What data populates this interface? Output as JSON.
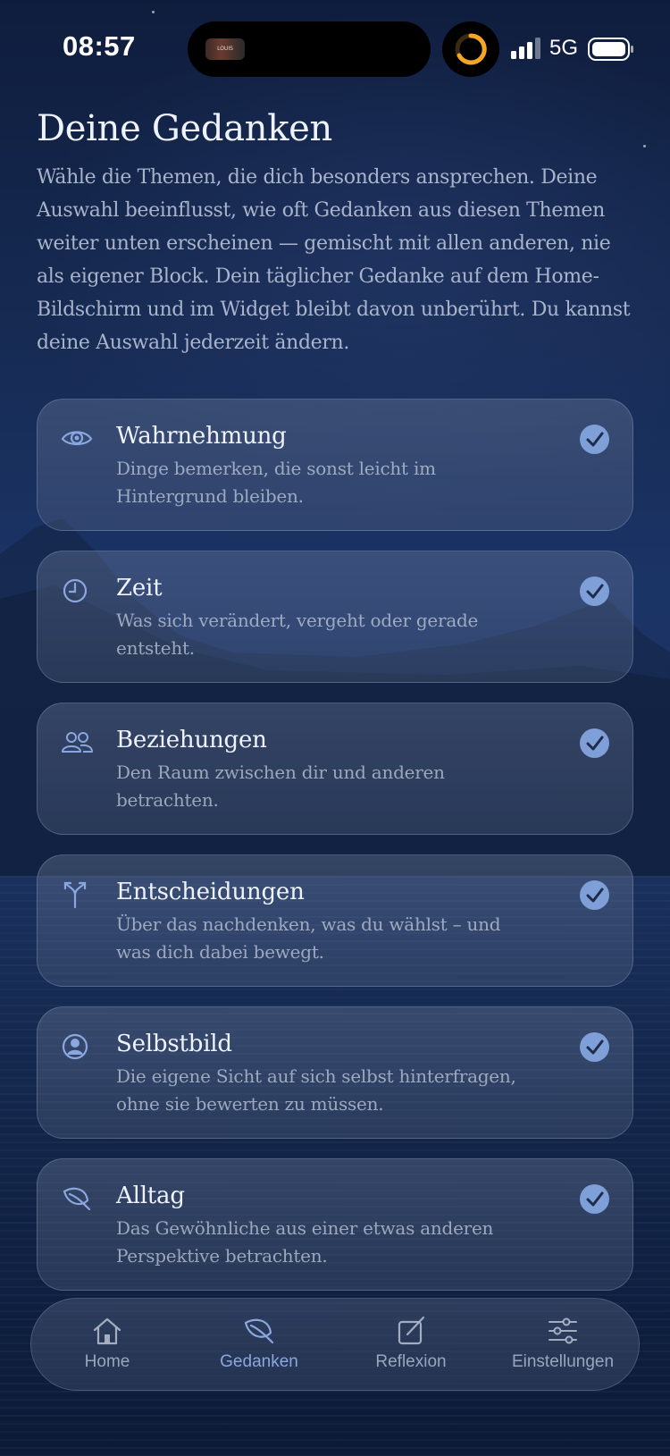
{
  "status_bar": {
    "time": "08:57",
    "network": "5G",
    "island_thumb_text": "LOUIS"
  },
  "page": {
    "title": "Deine Gedanken",
    "intro": "Wähle die Themen, die dich besonders ansprechen. Deine Auswahl beeinflusst, wie oft Gedanken aus diesen Themen weiter unten erscheinen — gemischt mit allen anderen, nie als eigener Block. Dein täglicher Gedanke auf dem Home-Bildschirm und im Widget bleibt davon unberührt. Du kannst deine Auswahl jederzeit ändern."
  },
  "topics": [
    {
      "title": "Wahrnehmung",
      "description": "Dinge bemerken, die sonst leicht im Hintergrund bleiben.",
      "icon": "eye-icon",
      "selected": true
    },
    {
      "title": "Zeit",
      "description": "Was sich verändert, vergeht oder gerade entsteht.",
      "icon": "clock-icon",
      "selected": true
    },
    {
      "title": "Beziehungen",
      "description": "Den Raum zwischen dir und anderen betrachten.",
      "icon": "people-icon",
      "selected": true
    },
    {
      "title": "Entscheidungen",
      "description": "Über das nachdenken, was du wählst – und was dich dabei bewegt.",
      "icon": "fork-icon",
      "selected": true
    },
    {
      "title": "Selbstbild",
      "description": "Die eigene Sicht auf sich selbst hinterfragen, ohne sie bewerten zu müssen.",
      "icon": "person-circle-icon",
      "selected": true
    },
    {
      "title": "Alltag",
      "description": "Das Gewöhnliche aus einer etwas anderen Perspektive betrachten.",
      "icon": "leaf-icon",
      "selected": true
    }
  ],
  "tab_bar": {
    "items": [
      {
        "label": "Home",
        "icon": "house-icon",
        "active": false
      },
      {
        "label": "Gedanken",
        "icon": "leaf-icon",
        "active": true
      },
      {
        "label": "Reflexion",
        "icon": "compose-icon",
        "active": false
      },
      {
        "label": "Einstellungen",
        "icon": "sliders-icon",
        "active": false
      }
    ]
  },
  "colors": {
    "accent": "#7e9fd8",
    "active_tab": "#8aa7df",
    "background_top": "#0f1d3d",
    "background_bottom": "#0a1733"
  }
}
